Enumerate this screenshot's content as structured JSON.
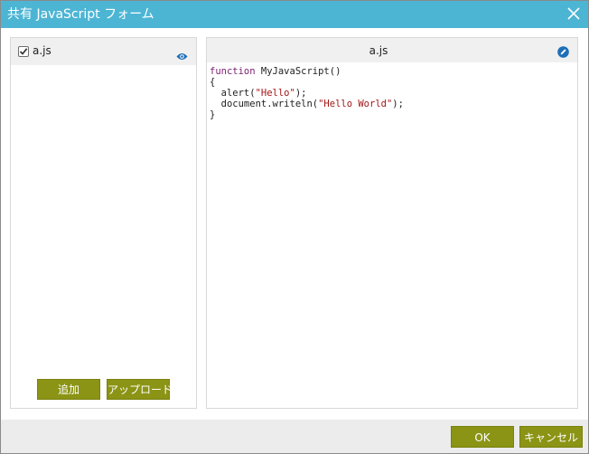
{
  "dialog": {
    "title": "共有 JavaScript フォーム",
    "close_icon": "close-icon"
  },
  "file_list": {
    "items": [
      {
        "name": "a.js",
        "checked": true,
        "view_icon": "eye-icon"
      }
    ],
    "add_label": "追加",
    "upload_label": "アップロード"
  },
  "editor": {
    "file_title": "a.js",
    "edit_icon": "pencil-icon",
    "code_lines": [
      "function MyJavaScript()",
      "{",
      "  alert(\"Hello\");",
      "  document.writeln(\"Hello World\");",
      "}"
    ]
  },
  "footer": {
    "ok_label": "OK",
    "cancel_label": "キャンセル"
  },
  "colors": {
    "titlebar": "#4db5d4",
    "button": "#8b9414",
    "edit_icon": "#1d6fb8",
    "keyword": "#7a1f6e",
    "string": "#a31515"
  }
}
